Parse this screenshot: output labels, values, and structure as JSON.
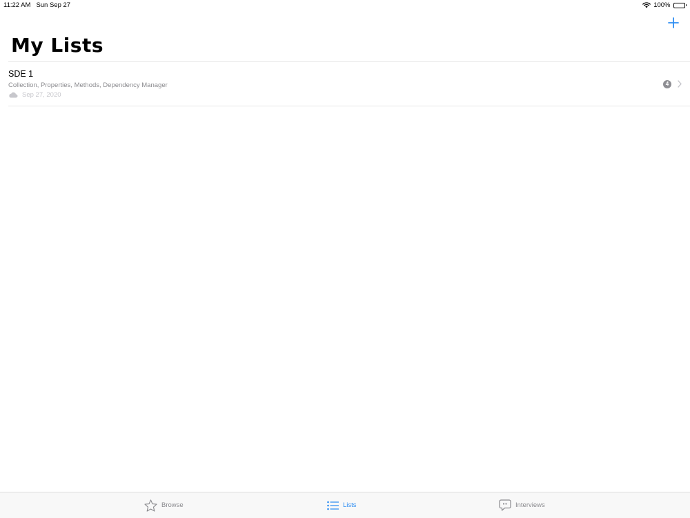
{
  "status_bar": {
    "time": "11:22 AM",
    "date": "Sun Sep 27",
    "battery": "100%",
    "icons": [
      "wifi-icon",
      "battery-icon"
    ]
  },
  "header": {
    "title": "My Lists",
    "add_icon": "plus-icon"
  },
  "lists": [
    {
      "title": "SDE 1",
      "subtitle": "Collection, Properties, Methods, Dependency Manager",
      "date": "Sep 27, 2020",
      "count": "4",
      "icons": [
        "cloud-icon",
        "chevron-right-icon"
      ]
    }
  ],
  "tab_bar": {
    "tabs": [
      {
        "label": "Browse",
        "icon": "star-icon",
        "active": false
      },
      {
        "label": "Lists",
        "icon": "list-icon",
        "active": true
      },
      {
        "label": "Interviews",
        "icon": "speech-bubble-icon",
        "active": false
      }
    ]
  },
  "colors": {
    "accent": "#2f8ef2",
    "inactive": "#8a8a8e",
    "secondary_text": "#8a8a8e",
    "tertiary_text": "#c7c7cc",
    "divider": "#e6e6e6",
    "tab_bar_background": "#f8f8f8"
  }
}
